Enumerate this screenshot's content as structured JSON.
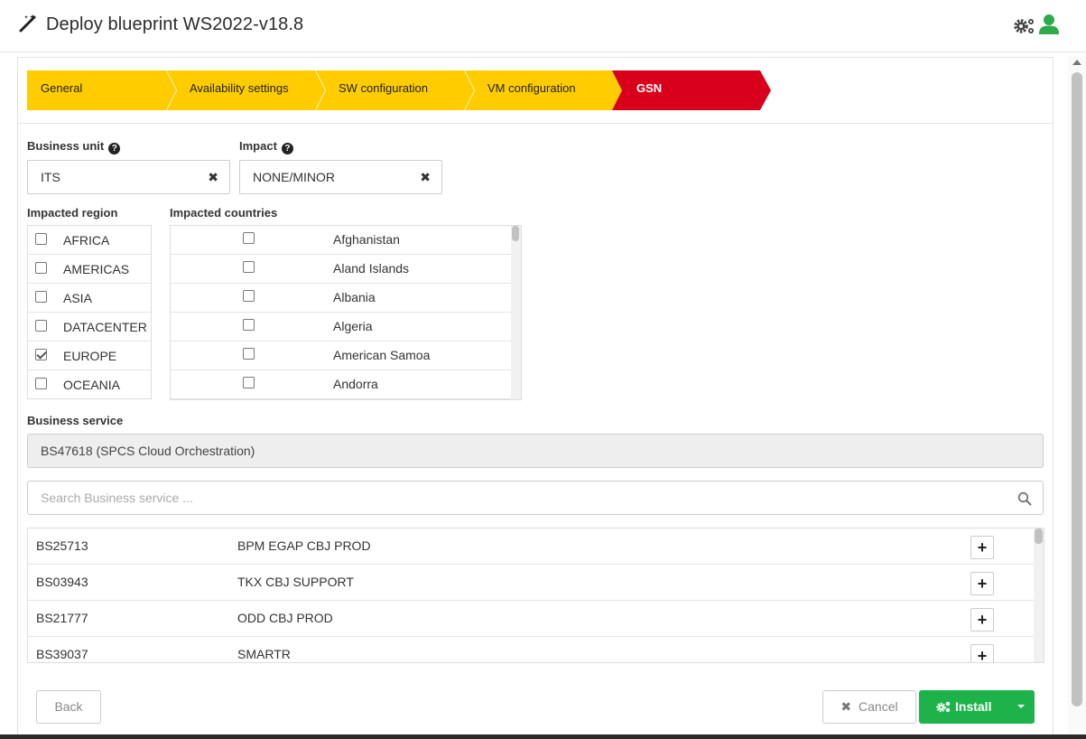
{
  "header": {
    "title": "Deploy blueprint WS2022-v18.8",
    "wand_icon": "magic-wand-icon",
    "settings_icon": "gears-icon",
    "user_icon": "user-icon",
    "user_icon_color": "#2eaa4a"
  },
  "steps": [
    {
      "label": "General",
      "state": "done"
    },
    {
      "label": "Availability settings",
      "state": "done"
    },
    {
      "label": "SW configuration",
      "state": "done"
    },
    {
      "label": "VM configuration",
      "state": "done"
    },
    {
      "label": "GSN",
      "state": "active"
    }
  ],
  "colors": {
    "step_done": "#ffcc00",
    "step_active": "#d9001b",
    "install_button": "#1db34a"
  },
  "form": {
    "business_unit": {
      "label": "Business unit",
      "value": "ITS"
    },
    "impact": {
      "label": "Impact",
      "value": "NONE/MINOR"
    },
    "impacted_region": {
      "label": "Impacted region",
      "options": [
        {
          "label": "AFRICA",
          "checked": false
        },
        {
          "label": "AMERICAS",
          "checked": false
        },
        {
          "label": "ASIA",
          "checked": false
        },
        {
          "label": "DATACENTER",
          "checked": false
        },
        {
          "label": "EUROPE",
          "checked": true
        },
        {
          "label": "OCEANIA",
          "checked": false
        }
      ]
    },
    "impacted_countries": {
      "label": "Impacted countries",
      "options": [
        {
          "label": "Afghanistan",
          "checked": false
        },
        {
          "label": "Aland Islands",
          "checked": false
        },
        {
          "label": "Albania",
          "checked": false
        },
        {
          "label": "Algeria",
          "checked": false
        },
        {
          "label": "American Samoa",
          "checked": false
        },
        {
          "label": "Andorra",
          "checked": false
        }
      ]
    },
    "business_service": {
      "label": "Business service",
      "selected": "BS47618 (SPCS Cloud Orchestration)",
      "search_placeholder": "Search Business service ...",
      "results": [
        {
          "id": "BS25713",
          "name": "BPM EGAP CBJ PROD"
        },
        {
          "id": "BS03943",
          "name": "TKX CBJ SUPPORT"
        },
        {
          "id": "BS21777",
          "name": "ODD CBJ PROD"
        },
        {
          "id": "BS39037",
          "name": "SMARTR"
        }
      ]
    }
  },
  "footer": {
    "back_label": "Back",
    "cancel_label": "Cancel",
    "install_label": "Install"
  }
}
